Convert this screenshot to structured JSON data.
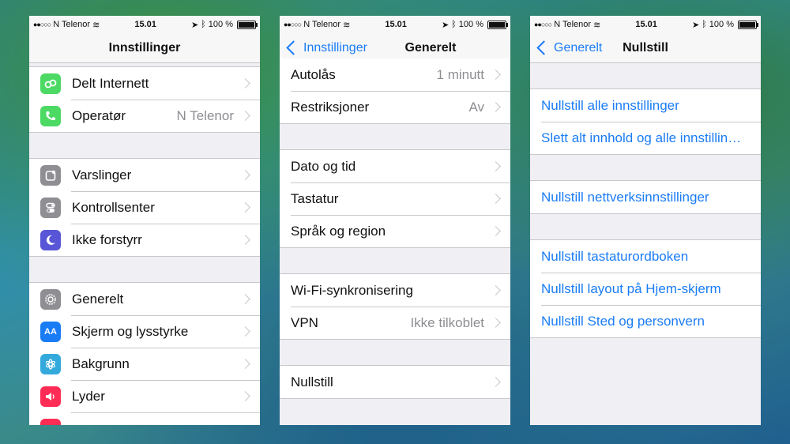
{
  "status": {
    "carrier": "N Telenor",
    "time": "15.01",
    "battery": "100 %"
  },
  "screens": [
    {
      "title": "Innstillinger",
      "groups": [
        {
          "rows": [
            {
              "label": "Delt Internett",
              "value": "",
              "icon": "hotspot-icon",
              "color": "#4cd964"
            },
            {
              "label": "Operatør",
              "value": "N Telenor",
              "icon": "phone-icon",
              "color": "#4cd964"
            }
          ]
        },
        {
          "rows": [
            {
              "label": "Varslinger",
              "value": "",
              "icon": "notifications-icon",
              "color": "#8e8e93"
            },
            {
              "label": "Kontrollsenter",
              "value": "",
              "icon": "control-center-icon",
              "color": "#8e8e93"
            },
            {
              "label": "Ikke forstyrr",
              "value": "",
              "icon": "moon-icon",
              "color": "#5856d6"
            }
          ]
        },
        {
          "rows": [
            {
              "label": "Generelt",
              "value": "",
              "icon": "gear-icon",
              "color": "#8e8e93"
            },
            {
              "label": "Skjerm og lysstyrke",
              "value": "",
              "icon": "display-icon",
              "color": "#1a7cf5"
            },
            {
              "label": "Bakgrunn",
              "value": "",
              "icon": "wallpaper-icon",
              "color": "#34aadc"
            },
            {
              "label": "Lyder",
              "value": "",
              "icon": "sound-icon",
              "color": "#ff2d55"
            }
          ]
        }
      ]
    },
    {
      "title": "Generelt",
      "back": "Innstillinger",
      "groups": [
        {
          "rows": [
            {
              "label": "Autolås",
              "value": "1 minutt"
            },
            {
              "label": "Restriksjoner",
              "value": "Av"
            }
          ]
        },
        {
          "rows": [
            {
              "label": "Dato og tid",
              "value": ""
            },
            {
              "label": "Tastatur",
              "value": ""
            },
            {
              "label": "Språk og region",
              "value": ""
            }
          ]
        },
        {
          "rows": [
            {
              "label": "Wi-Fi-synkronisering",
              "value": ""
            },
            {
              "label": "VPN",
              "value": "Ikke tilkoblet"
            }
          ]
        },
        {
          "rows": [
            {
              "label": "Nullstill",
              "value": ""
            }
          ]
        }
      ]
    },
    {
      "title": "Nullstill",
      "back": "Generelt",
      "groups": [
        {
          "rows": [
            {
              "label": "Nullstill alle innstillinger"
            },
            {
              "label": "Slett alt innhold og alle innstillin…"
            }
          ]
        },
        {
          "rows": [
            {
              "label": "Nullstill nettverksinnstillinger"
            }
          ]
        },
        {
          "rows": [
            {
              "label": "Nullstill tastaturordboken"
            },
            {
              "label": "Nullstill layout på Hjem-skjerm"
            },
            {
              "label": "Nullstill Sted og personvern"
            }
          ]
        }
      ]
    }
  ]
}
